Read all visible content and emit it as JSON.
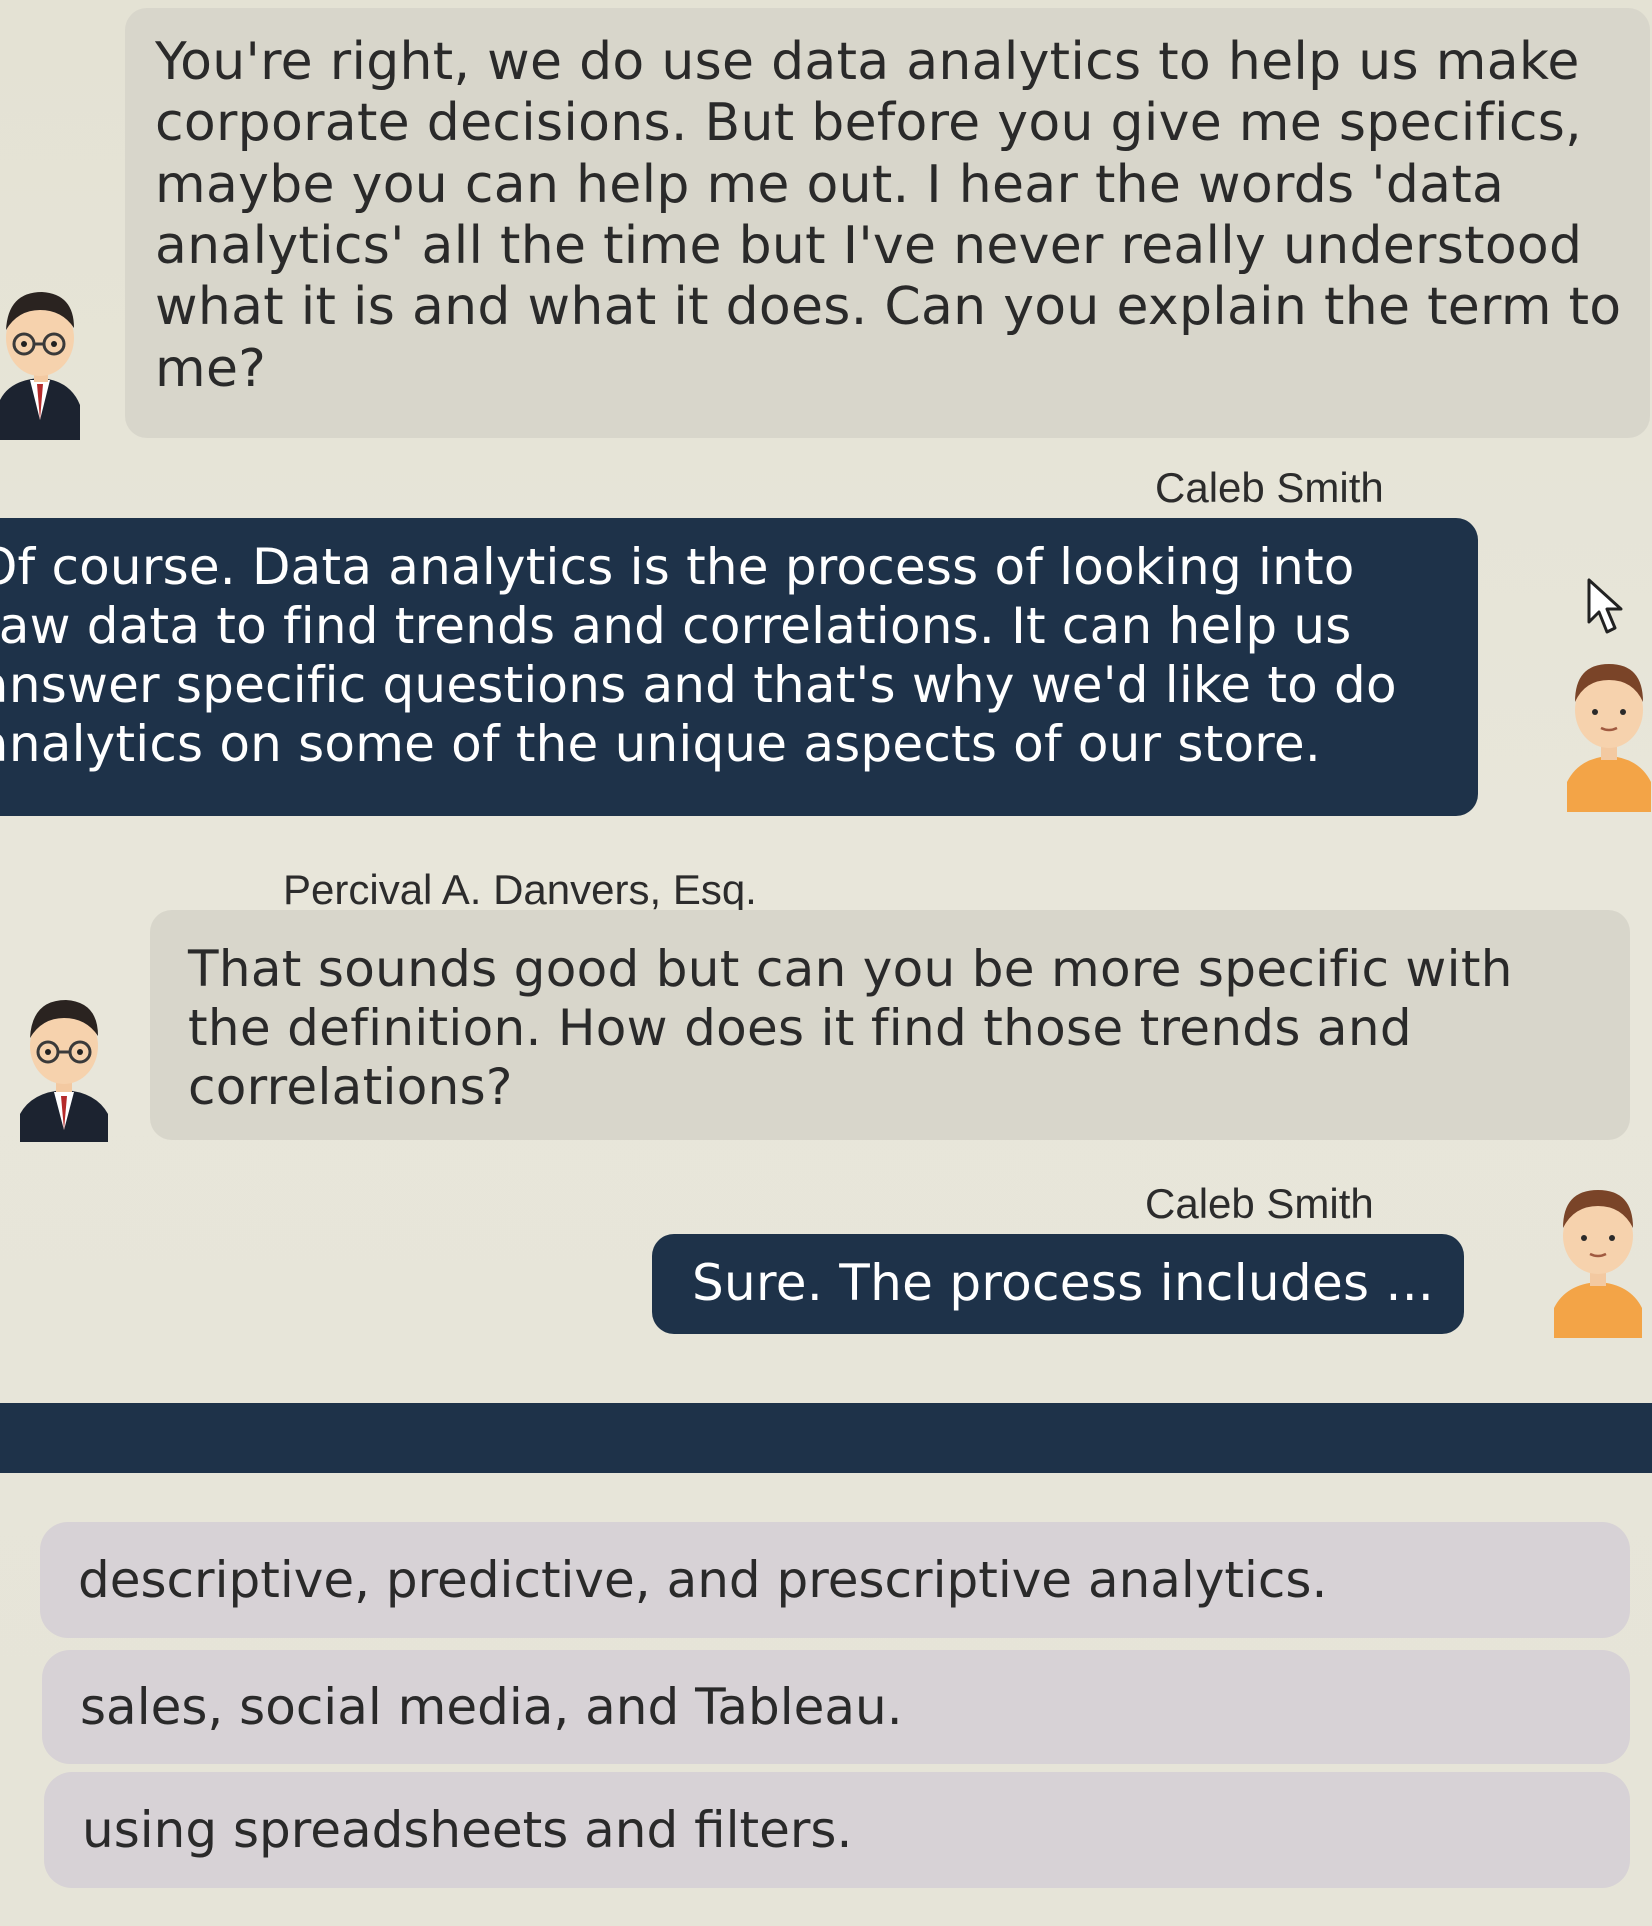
{
  "conversation": {
    "messages": [
      {
        "speaker": "",
        "text": "You're right, we do use data analytics to help us make corporate decisions. But before you give me specifics, maybe you can help me out. I hear the words 'data analytics' all the time but I've never really understood what it is and what it does. Can you explain the term to me?"
      },
      {
        "speaker": "Caleb Smith",
        "text": "Of course. Data analytics is the process of looking into raw data to find trends and correlations. It can help us answer specific questions and that's why we'd like to do analytics on some of the unique aspects of our store."
      },
      {
        "speaker": "Percival A. Danvers, Esq.",
        "text": "That sounds good but can you be more specific with the definition. How does it find those trends and correlations?"
      },
      {
        "speaker": "Caleb Smith",
        "text": "Sure. The process includes ..."
      }
    ]
  },
  "options": [
    {
      "label": "descriptive, predictive, and prescriptive analytics."
    },
    {
      "label": "sales, social media, and Tableau."
    },
    {
      "label": "using spreadsheets and filters."
    }
  ],
  "colors": {
    "navy": "#1e3249",
    "gray_bubble": "#d8d6cb",
    "option_bg": "#d7d2d6",
    "background": "#e6e4d7"
  }
}
